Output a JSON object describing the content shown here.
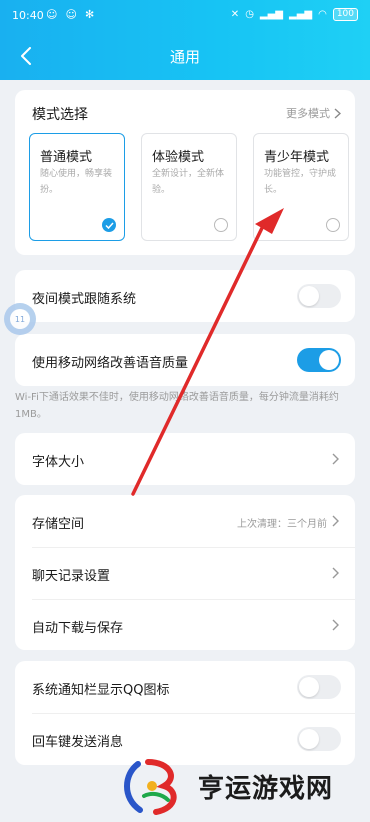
{
  "status_bar": {
    "time": "10:40",
    "battery": "100"
  },
  "nav": {
    "title": "通用"
  },
  "mode_section": {
    "title": "模式选择",
    "more_label": "更多模式",
    "options": [
      {
        "title": "普通模式",
        "desc": "随心使用，畅享装扮。",
        "selected": true
      },
      {
        "title": "体验模式",
        "desc": "全新设计，全新体验。",
        "selected": false
      },
      {
        "title": "青少年模式",
        "desc": "功能管控，守护成长。",
        "selected": false
      }
    ]
  },
  "night_mode": {
    "label": "夜间模式跟随系统",
    "enabled": false
  },
  "mobile_voice": {
    "label": "使用移动网络改善语音质量",
    "enabled": true,
    "hint": "Wi-Fi下通话效果不佳时，使用移动网络改善语音质量，每分钟流量消耗约1MB。"
  },
  "font_size": {
    "label": "字体大小"
  },
  "storage_group": {
    "storage_label": "存储空间",
    "storage_meta": "上次清理：三个月前",
    "chat_history_label": "聊天记录设置",
    "auto_download_label": "自动下载与保存"
  },
  "notify_group": {
    "qq_icon_label": "系统通知栏显示QQ图标",
    "qq_icon_enabled": false,
    "enter_send_label": "回车键发送消息",
    "enter_send_enabled": false
  },
  "float_bubble": {
    "text": "11"
  },
  "watermark": {
    "text": "亨运游戏网"
  },
  "colors": {
    "accent": "#1c9de6",
    "header_start": "#19b0f0",
    "annotation_arrow": "#e02a2a"
  }
}
